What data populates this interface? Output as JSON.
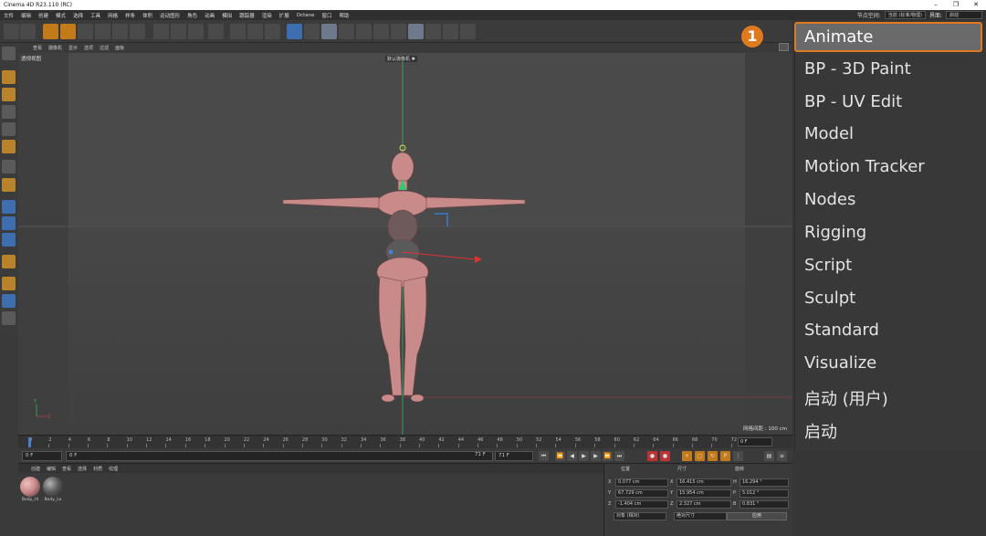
{
  "window": {
    "title": "Cinema 4D R23.110 (RC)",
    "buttons": [
      "–",
      "❐",
      "✕"
    ]
  },
  "menubar": {
    "items": [
      "文件",
      "编辑",
      "创建",
      "模式",
      "选择",
      "工具",
      "网格",
      "样条",
      "体积",
      "运动图形",
      "角色",
      "动画",
      "模拟",
      "跟踪器",
      "渲染",
      "扩展",
      "Octane",
      "窗口",
      "帮助"
    ],
    "node_space_label": "节点空间:",
    "node_space_value": "当前 (标准/物理)",
    "layout_label": "界面:",
    "layout_value": "启动"
  },
  "viewport": {
    "menu": [
      "查看",
      "摄像机",
      "显示",
      "选项",
      "过滤",
      "面板"
    ],
    "label": "透视视图",
    "camera": "默认摄像机 ✱",
    "grid_spacing": "网格间距 : 100 cm",
    "axis_y": "Y",
    "axis_z": "Z"
  },
  "timeline": {
    "ticks": [
      "0",
      "2",
      "4",
      "6",
      "8",
      "10",
      "12",
      "14",
      "16",
      "18",
      "20",
      "22",
      "24",
      "26",
      "28",
      "30",
      "32",
      "34",
      "36",
      "38",
      "40",
      "42",
      "44",
      "46",
      "48",
      "50",
      "52",
      "54",
      "56",
      "58",
      "60",
      "62",
      "64",
      "66",
      "68",
      "70",
      "72"
    ],
    "current_frame": "0 F"
  },
  "transport": {
    "start": "0 F",
    "current": "0 F",
    "end": "71 F",
    "end2": "71 F"
  },
  "materials": {
    "menu": [
      "创建",
      "编辑",
      "查看",
      "选择",
      "材质",
      "纹理"
    ],
    "items": [
      {
        "name": "Body_Hi",
        "color": "#c98a8a"
      },
      {
        "name": "Body_Lo",
        "color": "#5c5c5c"
      }
    ]
  },
  "coords": {
    "headers": {
      "position": "位置",
      "size": "尺寸",
      "rotation": "旋转"
    },
    "rows": [
      {
        "axis": "X",
        "pos": "0.077 cm",
        "size_axis": "X",
        "size": "16.415 cm",
        "rot_axis": "H",
        "rot": "16.294 °"
      },
      {
        "axis": "Y",
        "pos": "67.729 cm",
        "size_axis": "Y",
        "size": "15.954 cm",
        "rot_axis": "P",
        "rot": "5.012 °"
      },
      {
        "axis": "Z",
        "pos": "-1.404 cm",
        "size_axis": "Z",
        "size": "2.327 cm",
        "rot_axis": "B",
        "rot": "0.831 °"
      }
    ],
    "mode": "对象 (相对)",
    "size_mode": "绝对尺寸",
    "apply": "应用"
  },
  "layout_menu": {
    "badge": "1",
    "items": [
      "Animate",
      "BP - 3D Paint",
      "BP - UV Edit",
      "Model",
      "Motion Tracker",
      "Nodes",
      "Rigging",
      "Script",
      "Sculpt",
      "Standard",
      "Visualize",
      "启动 (用户)",
      "启动"
    ],
    "selected": "Animate"
  },
  "colors": {
    "accent": "#e07a1f",
    "viewport_bg": "#4a4a4a",
    "model": "#c98a8a"
  }
}
